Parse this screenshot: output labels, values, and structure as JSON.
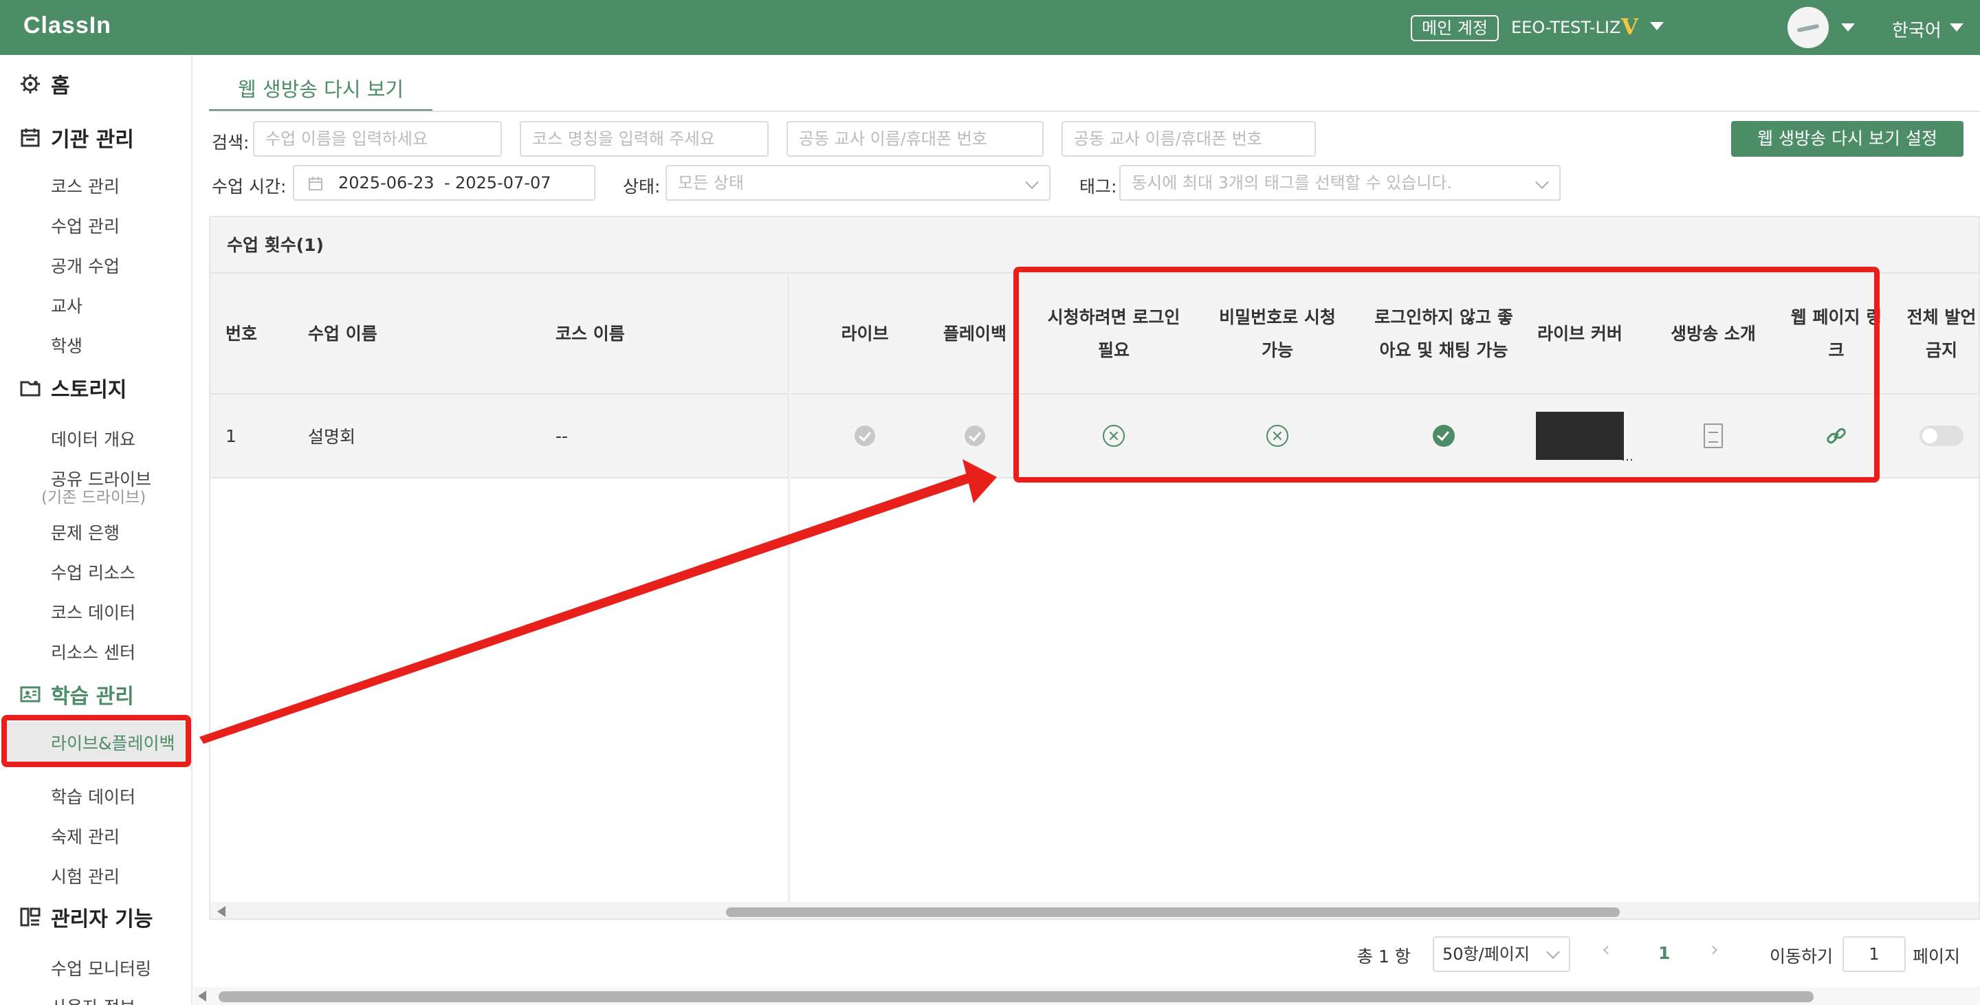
{
  "topbar": {
    "logo": "ClassIn",
    "account_badge": "메인 계정",
    "account_name": "EEO-TEST-LIZ",
    "vip_mark": "V",
    "language": "한국어"
  },
  "sidebar": {
    "sections": [
      {
        "label": "홈",
        "icon": "gear-icon"
      },
      {
        "label": "기관 관리",
        "icon": "calendar-icon"
      },
      {
        "label": "스토리지",
        "icon": "folder-icon"
      },
      {
        "label": "학습 관리",
        "icon": "id-card-icon"
      },
      {
        "label": "관리자 기능",
        "icon": "admin-icon"
      }
    ],
    "items": [
      "코스 관리",
      "수업 관리",
      "공개 수업",
      "교사",
      "학생",
      "데이터 개요",
      "공유 드라이브",
      "문제 은행",
      "수업 리소스",
      "코스 데이터",
      "리소스 센터",
      "라이브&플레이백",
      "학습 데이터",
      "숙제 관리",
      "시험 관리",
      "수업 모니터링",
      "사용자 정보"
    ],
    "sub_note": "(기존 드라이브)"
  },
  "tab": {
    "label": "웹 생방송 다시 보기"
  },
  "filters": {
    "search_label": "검색:",
    "search_inputs": [
      "수업 이름을 입력하세요",
      "코스 명칭을 입력해 주세요",
      "공동 교사 이름/휴대폰 번호",
      "공동 교사 이름/휴대폰 번호"
    ],
    "settings_button": "웹 생방송 다시 보기 설정",
    "time_label": "수업 시간:",
    "date_start": "2025-06-23",
    "date_sep": "-",
    "date_end": "2025-07-07",
    "status_label": "상태:",
    "status_placeholder": "모든 상태",
    "tag_label": "태그:",
    "tag_placeholder": "동시에 최대 3개의 태그를 선택할 수 있습니다."
  },
  "table": {
    "count_label": "수업 횟수(1)",
    "headers": {
      "no": "번호",
      "lesson": "수업 이름",
      "course": "코스 이름",
      "live": "라이브",
      "playback": "플레이백",
      "login_required": "시청하려면 로그인 필요",
      "password_view": "비밀번호로 시청 가능",
      "like_chat": "로그인하지 않고 좋아요 및 채팅 가능",
      "cover": "라이브 커버",
      "intro": "생방송 소개",
      "web_link": "웹 페이지 링크",
      "mute_all": "전체 발언 금지"
    },
    "rows": [
      {
        "no": "1",
        "lesson": "설명회",
        "course": "--",
        "live": "check-grey-icon",
        "playback": "check-grey-icon",
        "login_required": "x-circle-icon",
        "password_view": "x-circle-icon",
        "like_chat": "check-green-icon",
        "cover": "thumbnail",
        "intro": "document-icon",
        "web_link": "link-icon",
        "mute_all": "toggle-off"
      }
    ]
  },
  "pagination": {
    "total": "총 1 항",
    "page_size": "50항/페이지",
    "current_page": "1",
    "goto_label": "이동하기",
    "goto_value": "1",
    "page_suffix": "페이지"
  },
  "colors": {
    "brand": "#4c8c67",
    "annotation": "#e8201c",
    "vip": "#f3c742"
  }
}
